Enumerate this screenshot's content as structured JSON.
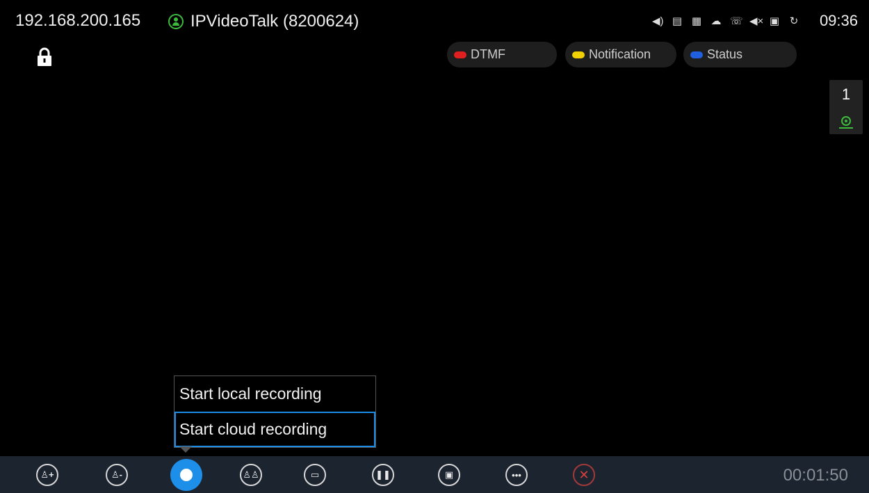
{
  "statusbar": {
    "ip": "192.168.200.165",
    "account": "IPVideoTalk (8200624)",
    "time": "09:36",
    "icons": [
      "volume-icon",
      "contacts-icon",
      "sim-icon",
      "cloud-icon",
      "call-forward-icon",
      "mute-icon",
      "sd-card-icon",
      "sync-icon"
    ]
  },
  "pills": [
    {
      "label": "DTMF",
      "color": "#e02020"
    },
    {
      "label": "Notification",
      "color": "#f0d000"
    },
    {
      "label": "Status",
      "color": "#2060e0"
    }
  ],
  "side_panel": {
    "count": "1"
  },
  "record_menu": {
    "items": [
      "Start local recording",
      "Start cloud recording"
    ],
    "selected_index": 1
  },
  "toolbar": {
    "buttons": [
      "add-participant",
      "remove-participant",
      "record",
      "participants",
      "presentation",
      "hold",
      "camera",
      "more",
      "end-call"
    ],
    "timer": "00:01:50"
  },
  "colors": {
    "accent": "#1e8fe8",
    "registered": "#3dbb3d",
    "toolbar_bg": "#1c2430"
  }
}
